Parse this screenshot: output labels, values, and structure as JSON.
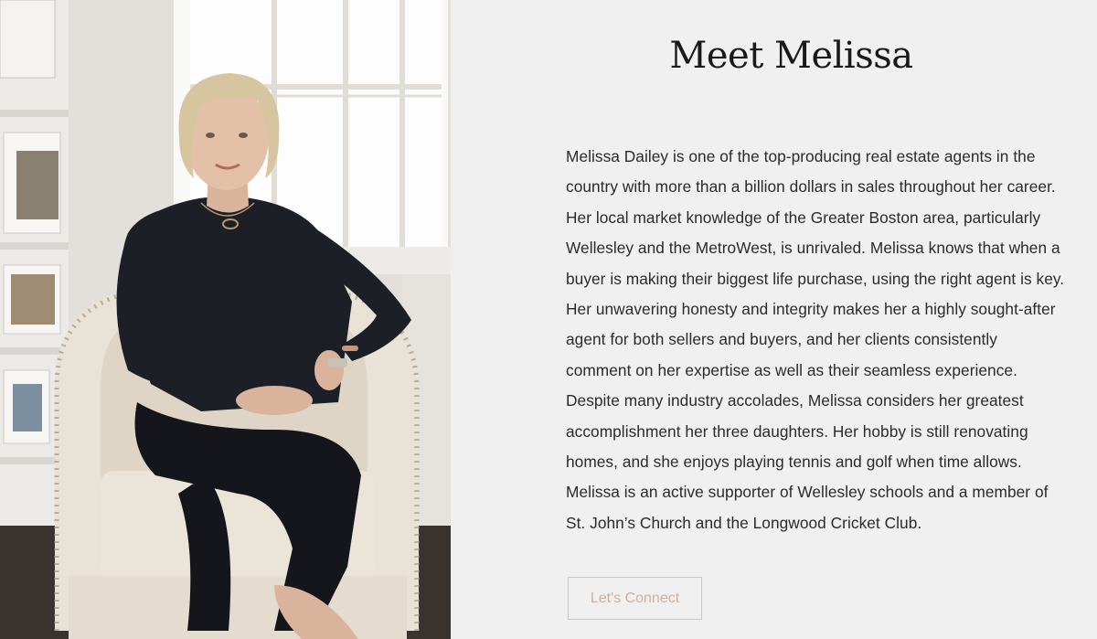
{
  "heading": "Meet Melissa",
  "bio_lines": [
    "Melissa Dailey is one of the top-producing real estate agents in the",
    "country with more than a billion dollars in sales throughout her career.",
    "Her local market knowledge of the Greater Boston area, particularly",
    "Wellesley and the MetroWest, is unrivaled. Melissa knows that when a",
    "buyer is making their biggest life purchase, using the right agent is key.",
    "Her unwavering honesty and integrity makes her a highly sought-after",
    "agent for both sellers and buyers, and her clients consistently",
    "comment on her expertise as well as their seamless experience.",
    "Despite many industry accolades, Melissa considers her greatest",
    "accomplishment her three daughters. Her hobby is still renovating",
    "homes, and she enjoys playing tennis and golf when time allows.",
    "Melissa is an active supporter of Wellesley schools and a member of",
    "St. John’s Church and the Longwood Cricket Club."
  ],
  "button_label": "Let's Connect",
  "colors": {
    "background": "#f0f0f0",
    "text": "#2b2b2b",
    "heading": "#1a1a1a",
    "button_border": "#d9c4b6",
    "button_text": "#c9b2a4"
  }
}
